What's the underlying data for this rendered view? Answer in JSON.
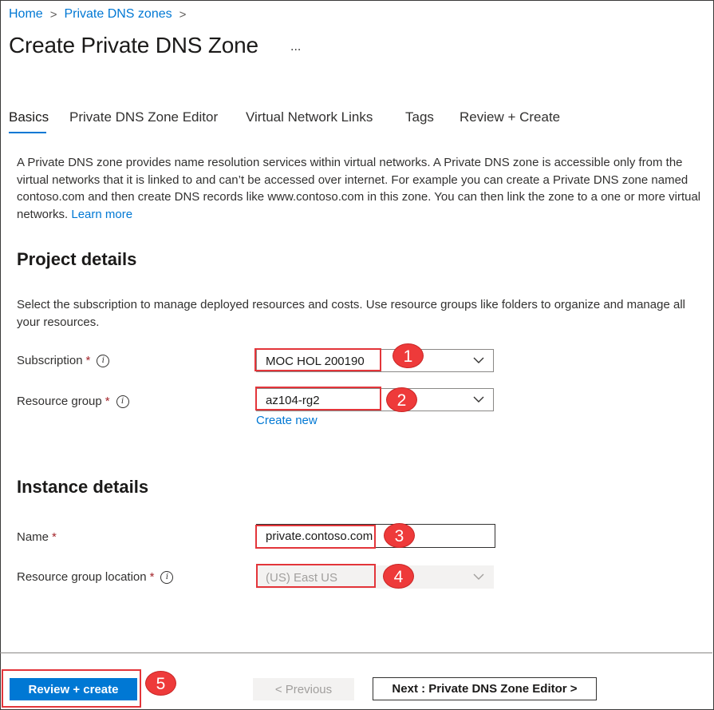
{
  "breadcrumb": {
    "items": [
      "Home",
      "Private DNS zones"
    ],
    "separator": ">"
  },
  "page": {
    "title": "Create Private DNS Zone",
    "more_label": "..."
  },
  "tabs": [
    {
      "label": "Basics",
      "active": true
    },
    {
      "label": "Private DNS Zone Editor",
      "active": false
    },
    {
      "label": "Virtual Network Links",
      "active": false
    },
    {
      "label": "Tags",
      "active": false
    },
    {
      "label": "Review + Create",
      "active": false
    }
  ],
  "intro": {
    "text": "A Private DNS zone provides name resolution services within virtual networks. A Private DNS zone is accessible only from the virtual networks that it is linked to and can’t be accessed over internet. For example you can create a Private DNS zone named contoso.com and then create DNS records like www.contoso.com in this zone. You can then link the zone to a one or more virtual networks.",
    "learn_more": "Learn more"
  },
  "project": {
    "heading": "Project details",
    "description": "Select the subscription to manage deployed resources and costs. Use resource groups like folders to organize and manage all your resources.",
    "subscription_label": "Subscription",
    "subscription_value": "MOC HOL 200190",
    "resource_group_label": "Resource group",
    "resource_group_value": "az104-rg2",
    "create_new": "Create new"
  },
  "instance": {
    "heading": "Instance details",
    "name_label": "Name",
    "name_value": "private.contoso.com",
    "location_label": "Resource group location",
    "location_value": "(US) East US"
  },
  "markers": [
    "1",
    "2",
    "3",
    "4",
    "5"
  ],
  "footer": {
    "review_create": "Review + create",
    "previous": "< Previous",
    "next": "Next : Private DNS Zone Editor >"
  },
  "colors": {
    "accent": "#0078d4",
    "highlight": "#e3353a",
    "required": "#a4262c"
  }
}
